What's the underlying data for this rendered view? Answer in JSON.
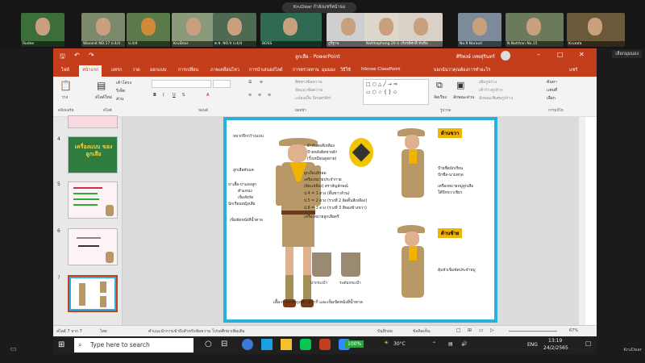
{
  "meeting": {
    "share_label": "KruDear กำลังแชร์หน้าจอ",
    "view_button": "เลือกมุมมอง",
    "bottom_right": "KruDear",
    "participants": [
      {
        "name": "Rudee"
      },
      {
        "name": "Wasanit NO.17 ป.4/4"
      },
      {
        "name": "ป.4/4"
      },
      {
        "name": "KruDear"
      },
      {
        "name": "ด.ช. NO.9 ป.4/4"
      },
      {
        "name": "BOSS"
      },
      {
        "name": "ภูริฐาน"
      },
      {
        "name": "Natthaphong 20 ป.4/4"
      },
      {
        "name": "เกียรติศักดิ์ ทับทิม"
      },
      {
        "name": "No.9 Naravit"
      },
      {
        "name": "N.Natthan No.15"
      },
      {
        "name": "Kruแอน"
      }
    ]
  },
  "powerpoint": {
    "doc_title": "ลูกเสือ - PowerPoint",
    "search_label": "ค้นหา",
    "user_name": "ศิริพงษ์ เทพสุรินทร์",
    "share_label": "แชร์",
    "ribbon_tabs": [
      "ไฟล์",
      "หน้าแรก",
      "แทรก",
      "วาด",
      "ออกแบบ",
      "การเปลี่ยน",
      "ภาพเคลื่อนไหว",
      "การนำเสนอสไลด์",
      "การตรวจทาน",
      "มุมมอง",
      "วิธีใช้",
      "Inknoe ClassPoint",
      "บอกฉันว่าคุณต้องการทำอะไร"
    ],
    "active_tab_index": 1,
    "ribbon_groups": [
      "คลิปบอร์ด",
      "สไลด์",
      "ฟอนต์",
      "ย่อหน้า",
      "รูปวาด",
      "การแก้ไข"
    ],
    "ribbon_buttons": {
      "paste": "วาง",
      "new_slide": "สไลด์ใหม่",
      "layout": "เค้าโครง",
      "reset": "รีเซ็ต",
      "section": "ส่วน",
      "arrange": "จัดเรียง",
      "quick_styles": "ลักษณะด่วน",
      "shape_fill": "เติมรูปร่าง",
      "shape_outline": "เค้าร่างรูปร่าง",
      "shape_effects": "ลักษณะพิเศษรูปร่าง",
      "find": "ค้นหา",
      "replace": "แทนที่",
      "select": "เลือก",
      "text_direction": "ทิศทางข้อความ",
      "align_text": "จัดแนวข้อความ",
      "smartart": "แปลงเป็น SmartArt"
    },
    "slide_numbers": [
      "4",
      "5",
      "6",
      "7"
    ],
    "thumb4_text": "เครื่องแบบ ของลูกเสือ",
    "status": {
      "slide_info": "สไลด์ 7 จาก 7",
      "language": "ไทย",
      "notes_hint": "คำแนะนำการเข้าถึงสำหรับข้อความ โปรดศึกษาเพิ่มเติม",
      "notes": "บันทึกย่อ",
      "comments": "ข้อคิดเห็น",
      "zoom": "67%"
    }
  },
  "slide": {
    "callouts_left": [
      "หมวกปีกกว้างแบบ",
      "ผ้าผูกคอ",
      "ผ้าพันคอสีเหลือง",
      "บ่าและขลิบตามประเภท",
      "ดิ้นเหลืองตามความ",
      "ลูกเสือคับแค",
      "บ่าเสื้อ-บ่าแดงลูก",
      "ตำแหน่ง",
      "เข็มสังกัด",
      "นักเรียนหญิงเสือ",
      "เข็มขัดหนังสีน้ำตาล"
    ],
    "callouts_middle": [
      "ผ้าพันคอสีเหลือง",
      "ป้ายหลังติดชายผ้า",
      "(รั้งเหมือนสูงยาย)",
      "ผูกเงื่อนพิรอด",
      "เครื่องหมายประจำกาย",
      "(ติดแหลือง) ตราสัญลักษณ์",
      "ป.4 = 1 ดวง (ดิ้นขาวล้วน)",
      "ป.5 = 2 ดวง (รวงที่ 2 ติดดิ้นสีเหลือง)",
      "ป.6 = 3 ดวง (รวงที่ 3 สีทองข้างขวา)",
      "เครื่องหมายลูกเสือตรี"
    ],
    "section_right": "ด้านขวา",
    "section_left": "ด้านซ้าย",
    "callouts_right": [
      "ป้ายชื่อนักเรียน",
      "ปักชื่อ-นามสกุล",
      "เครื่องหมายหมู่ลูกเสือ",
      "ใต้ปีกขวาเขียว"
    ],
    "callouts_left_side": [
      "ตุ้มหัวเข็มขัดประจำหมู่"
    ],
    "pocket_labels": [
      "บ่ากระเป๋า",
      "ระดับกระเป๋า"
    ],
    "caption": "เสื้อ-กางเกง-ถุงเท้า สีกากี และเข็มขัดหนังสีน้ำตาล"
  },
  "taskbar": {
    "search_placeholder": "Type here to search",
    "battery": "100%",
    "temperature": "30°C",
    "language": "ENG",
    "time": "13:19",
    "date": "24/2/2565"
  },
  "colors": {
    "ppt_accent": "#c43e1c",
    "slide_border": "#2ab0de",
    "scarf": "#f0b400",
    "uniform": "#b99868"
  }
}
